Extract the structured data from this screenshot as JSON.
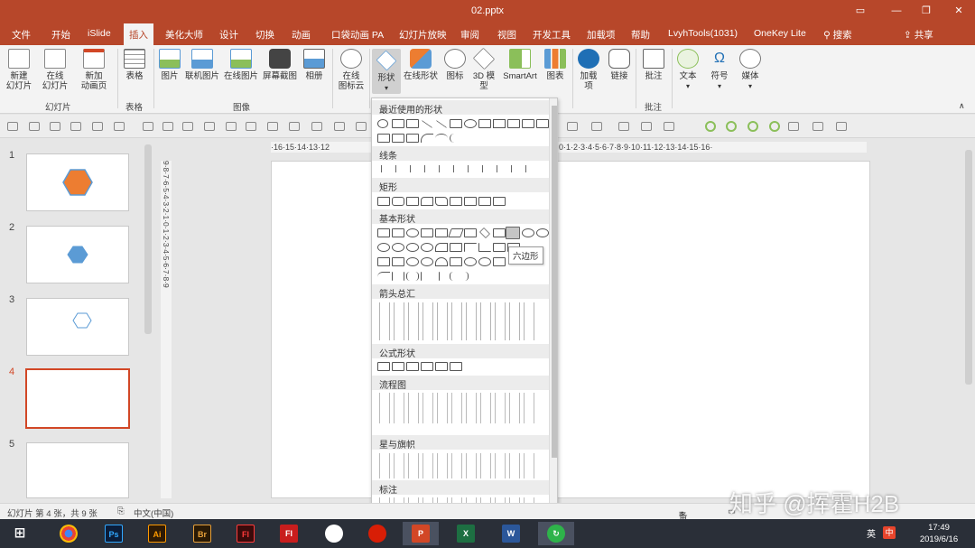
{
  "window": {
    "title": "02.pptx"
  },
  "menu": {
    "tabs": [
      "文件",
      "开始",
      "iSlide",
      "插入",
      "美化大师",
      "设计",
      "切换",
      "动画",
      "口袋动画 PA",
      "幻灯片放映",
      "审阅",
      "视图",
      "开发工具",
      "加载项",
      "帮助",
      "LvyhTools(1031)",
      "OneKey Lite"
    ],
    "active_tab": "插入",
    "search": "搜索",
    "share": "共享"
  },
  "ribbon": {
    "buttons": {
      "new_slide": "新建\n幻灯片",
      "online_slide": "在线\n幻灯片",
      "new_anim_page": "新加\n动画页",
      "table": "表格",
      "picture": "图片",
      "online_picture": "联机图片",
      "online_picture2": "在线图片",
      "screenshot": "屏幕截图",
      "album": "相册",
      "online_icon_cloud": "在线\n图标云",
      "shapes": "形状",
      "online_shapes": "在线形状",
      "icons": "图标",
      "model3d": "3D 模\n型",
      "smartart": "SmartArt",
      "chart": "图表",
      "addins": "加载\n项",
      "link": "链接",
      "comment": "批注",
      "text": "文本",
      "symbol": "符号",
      "media": "媒体"
    },
    "groups": {
      "slides": "幻灯片",
      "tables": "表格",
      "images": "图像",
      "comments": "批注"
    }
  },
  "ruler": {
    "horizontal": "·16·15·14·13·12",
    "horizontal_right": "·0·1·2·3·4·5·6·7·8·9·10·11·12·13·14·15·16·",
    "vertical": "9·8·7·6·5·4·3·2·1·0·1·2·3·4·5·6·7·8·9"
  },
  "thumbnails": [
    {
      "num": "1",
      "shape": "hexagon-orange-large"
    },
    {
      "num": "2",
      "shape": "hexagon-blue-small"
    },
    {
      "num": "3",
      "shape": "hexagon-outline"
    },
    {
      "num": "4",
      "shape": "none",
      "selected": true
    },
    {
      "num": "5",
      "shape": "none"
    }
  ],
  "shapes_dropdown": {
    "sections": [
      "最近使用的形状",
      "线条",
      "矩形",
      "基本形状",
      "箭头总汇",
      "公式形状",
      "流程图",
      "星与旗帜",
      "标注"
    ],
    "tooltip": "六边形"
  },
  "statusbar": {
    "slide_info": "幻灯片 第 4 张，共 9 张",
    "language": "中文(中国)",
    "notes": "备注"
  },
  "taskbar": {
    "apps": [
      "Ps",
      "Ai",
      "Br",
      "Fl",
      "Fl"
    ],
    "tray_lang": "英",
    "ime": "中",
    "time": "17:49",
    "date": "2019/6/16"
  },
  "watermark": "知乎 @挥霍H2B",
  "colors": {
    "accent": "#b7472a",
    "selection": "#d24726",
    "hex_orange": "#ed7d31",
    "hex_blue": "#5b9bd5"
  }
}
